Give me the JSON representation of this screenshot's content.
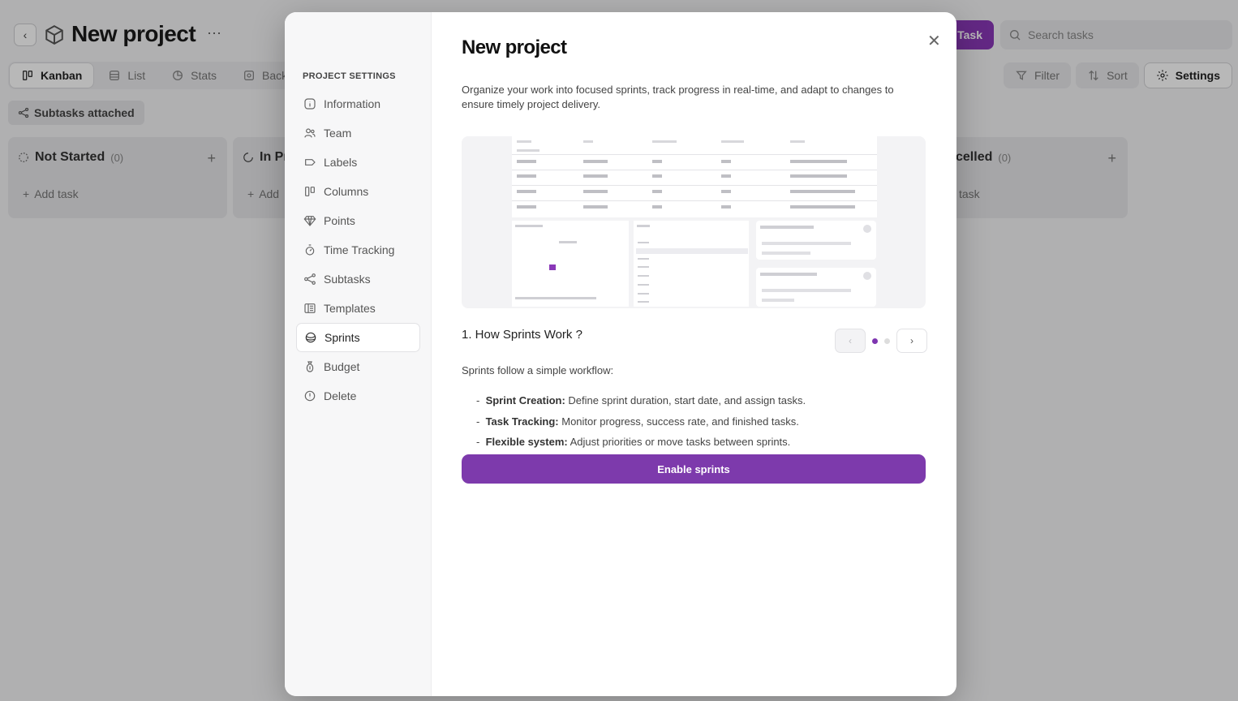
{
  "header": {
    "title": "New project",
    "more": "···",
    "task_button": "Task",
    "search_placeholder": "Search tasks"
  },
  "tabs": [
    {
      "label": "Kanban",
      "active": true
    },
    {
      "label": "List"
    },
    {
      "label": "Stats"
    },
    {
      "label": "Backlo"
    }
  ],
  "tools": {
    "filter": "Filter",
    "sort": "Sort",
    "settings": "Settings"
  },
  "chip": "Subtasks attached",
  "columns": [
    {
      "title": "Not Started",
      "count": "(0)",
      "add": "Add task"
    },
    {
      "title": "In Pr",
      "add": "Add"
    },
    {
      "title": "celled",
      "count": "(0)",
      "add": "task"
    }
  ],
  "modal": {
    "sidebar_heading": "PROJECT SETTINGS",
    "sidebar_items": [
      {
        "label": "Information",
        "icon": "info-icon"
      },
      {
        "label": "Team",
        "icon": "team-icon"
      },
      {
        "label": "Labels",
        "icon": "label-icon"
      },
      {
        "label": "Columns",
        "icon": "columns-icon"
      },
      {
        "label": "Points",
        "icon": "diamond-icon"
      },
      {
        "label": "Time Tracking",
        "icon": "stopwatch-icon"
      },
      {
        "label": "Subtasks",
        "icon": "subtasks-icon"
      },
      {
        "label": "Templates",
        "icon": "template-icon"
      },
      {
        "label": "Sprints",
        "icon": "sprint-icon",
        "active": true
      },
      {
        "label": "Budget",
        "icon": "budget-icon"
      },
      {
        "label": "Delete",
        "icon": "delete-icon"
      }
    ],
    "title": "New project",
    "description": "Organize your work into focused sprints, track progress in real-time, and adapt to changes to ensure timely project delivery.",
    "section_title": "1. How Sprints Work ?",
    "intro": "Sprints follow a simple workflow:",
    "bullets": [
      {
        "bold": "Sprint Creation:",
        "text": " Define sprint duration, start date, and assign tasks."
      },
      {
        "bold": "Task Tracking:",
        "text": " Monitor progress, success rate, and finished tasks."
      },
      {
        "bold": "Flexible system:",
        "text": " Adjust priorities or move tasks between sprints."
      }
    ],
    "enable_button": "Enable sprints",
    "accent_color": "#7d3aac"
  }
}
